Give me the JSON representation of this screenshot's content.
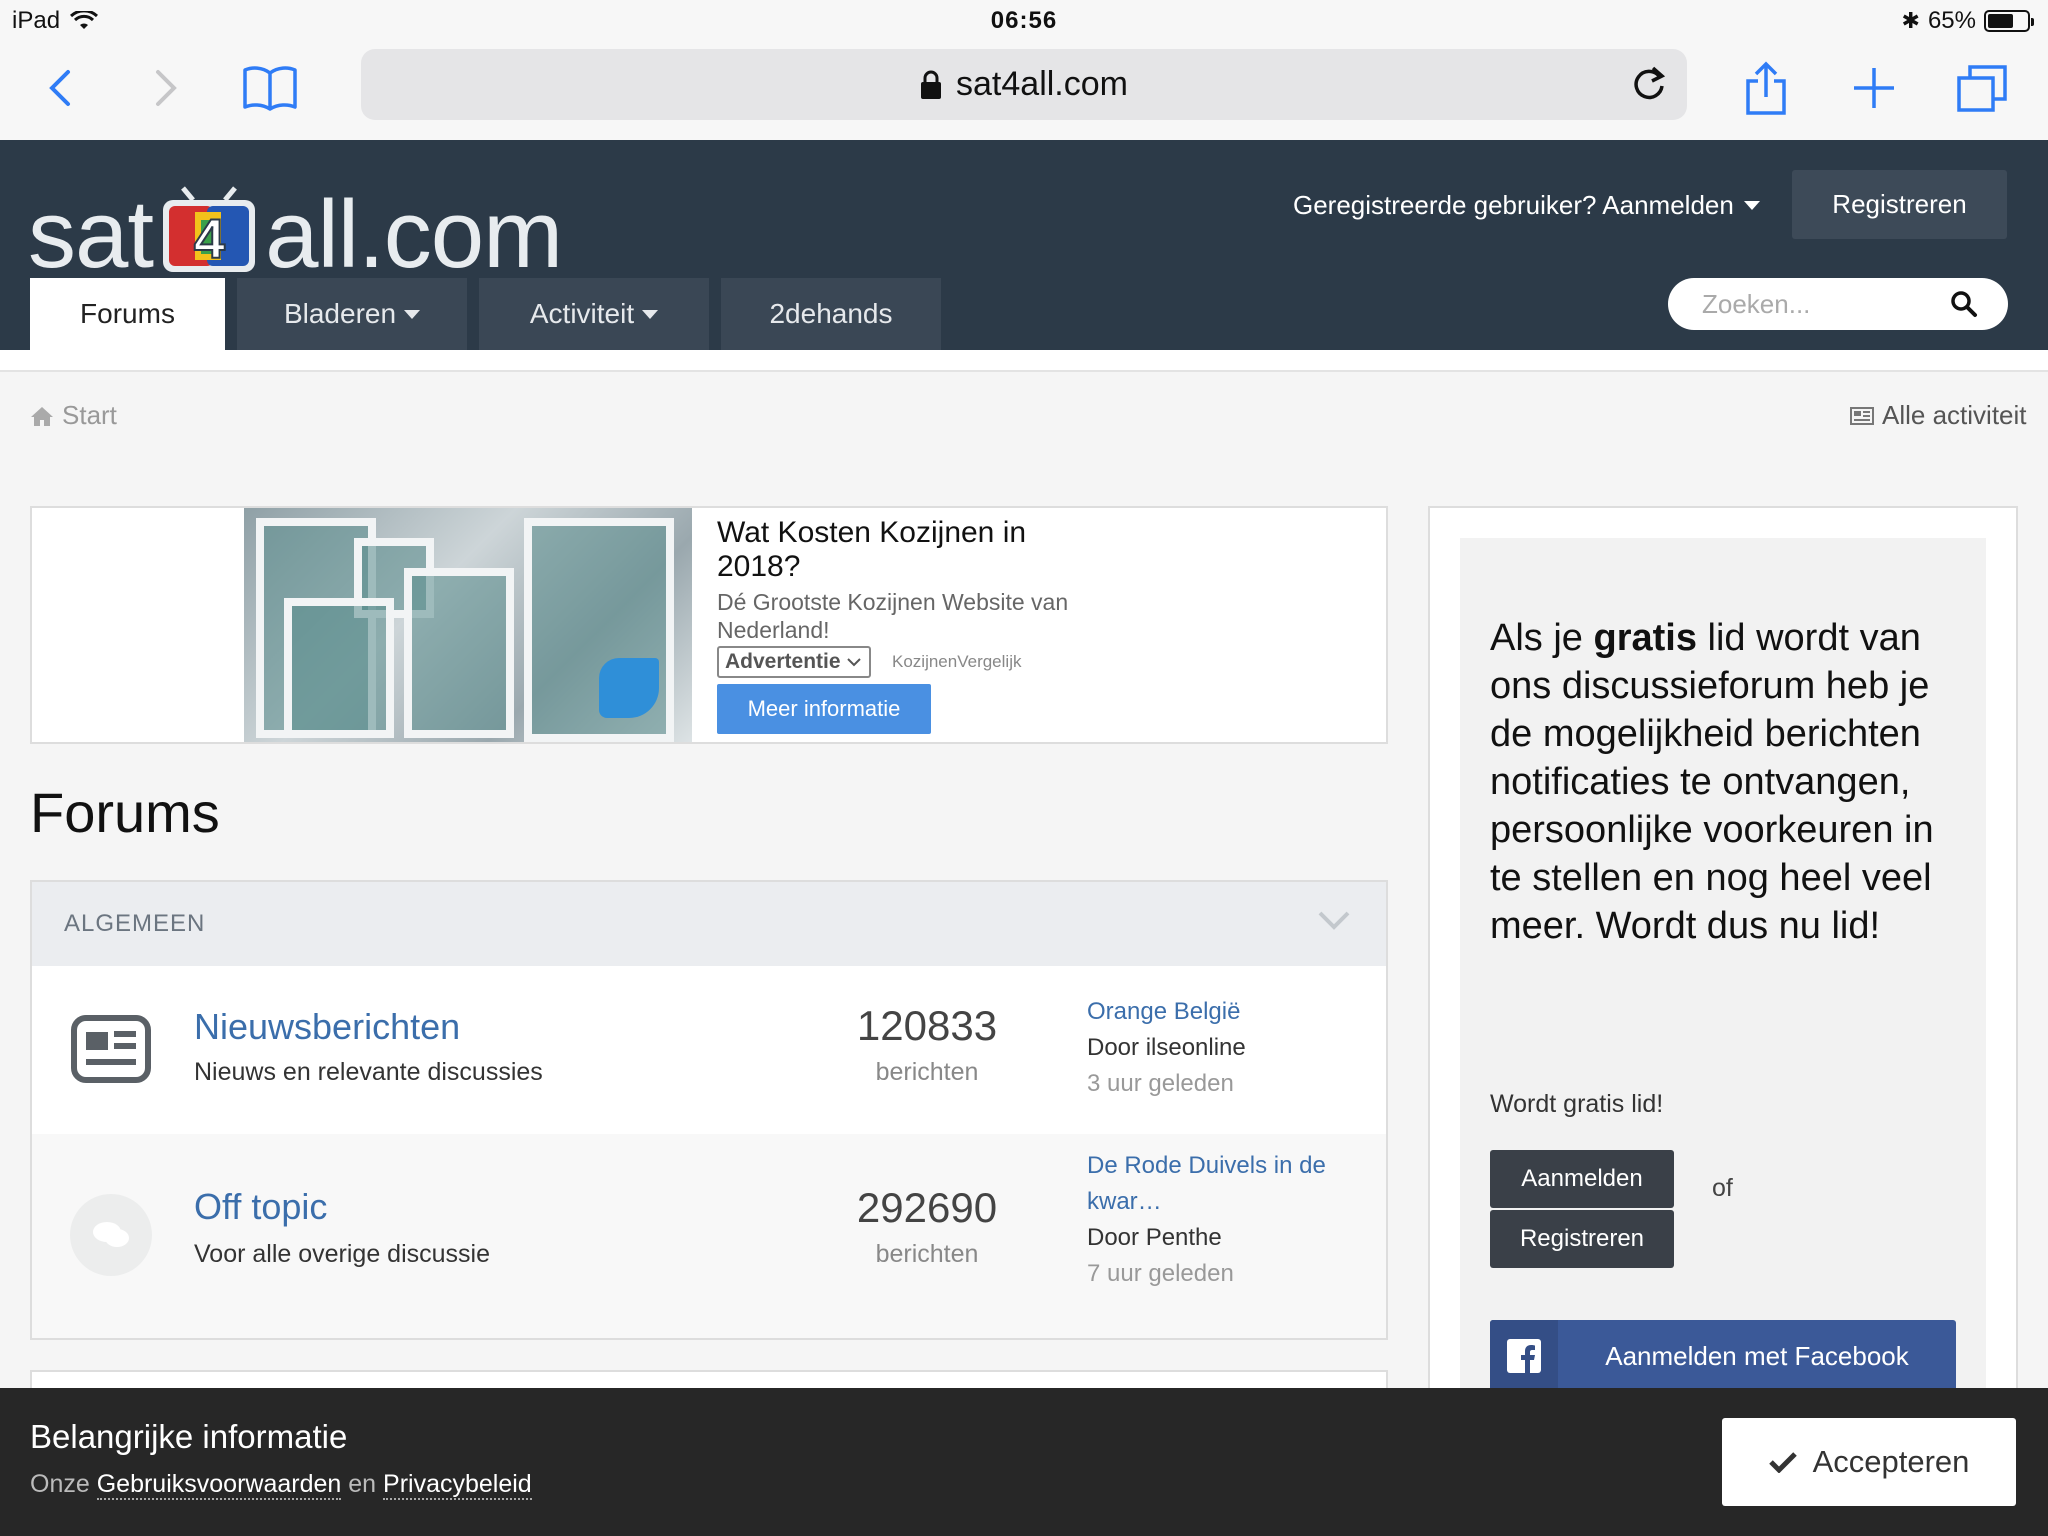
{
  "status_bar": {
    "device": "iPad",
    "time": "06:56",
    "battery": "65%",
    "battery_level": 0.65
  },
  "browser": {
    "url": "sat4all.com"
  },
  "site": {
    "logo_left": "sat",
    "logo_mid": "4",
    "logo_right": "all.com",
    "signin_label": "Geregistreerde gebruiker? Aanmelden",
    "register_label": "Registreren",
    "nav": {
      "forums": "Forums",
      "browse": "Bladeren",
      "activity": "Activiteit",
      "secondhand": "2dehands"
    },
    "search_placeholder": "Zoeken..."
  },
  "breadcrumb": {
    "home": "Start",
    "all_activity": "Alle activiteit"
  },
  "ad": {
    "title": "Wat Kosten Kozijnen in 2018?",
    "subtitle": "Dé Grootste Kozijnen Website van Nederland!",
    "tag": "Advertentie",
    "source": "KozijnenVergelijk",
    "cta": "Meer informatie"
  },
  "forums": {
    "heading": "Forums",
    "category": "ALGEMEEN",
    "rows": [
      {
        "title": "Nieuwsberichten",
        "description": "Nieuws en relevante discussies",
        "count": "120833",
        "count_label": "berichten",
        "last_title": "Orange België",
        "last_by": "Door ilseonline",
        "last_when": "3 uur geleden"
      },
      {
        "title": "Off topic",
        "description": "Voor alle overige discussie",
        "count": "292690",
        "count_label": "berichten",
        "last_title": "De Rode Duivels in de kwar…",
        "last_by": "Door Penthe",
        "last_when": "7 uur geleden"
      }
    ]
  },
  "sidebar": {
    "msg_pre": "Als je ",
    "msg_bold": "gratis",
    "msg_post": " lid wordt van ons discussieforum heb je de mogelijkheid berichten notificaties te ontvangen, persoonlijke voorkeuren in te stellen en nog heel veel meer. Wordt dus nu lid!",
    "cta_text": "Wordt gratis lid!",
    "signin": "Aanmelden",
    "or": "of",
    "register": "Registreren",
    "facebook": "Aanmelden met Facebook"
  },
  "banner": {
    "title": "Belangrijke informatie",
    "prefix": "Onze",
    "terms": "Gebruiksvoorwaarden",
    "and": "en",
    "privacy": "Privacybeleid",
    "accept": "Accepteren"
  }
}
